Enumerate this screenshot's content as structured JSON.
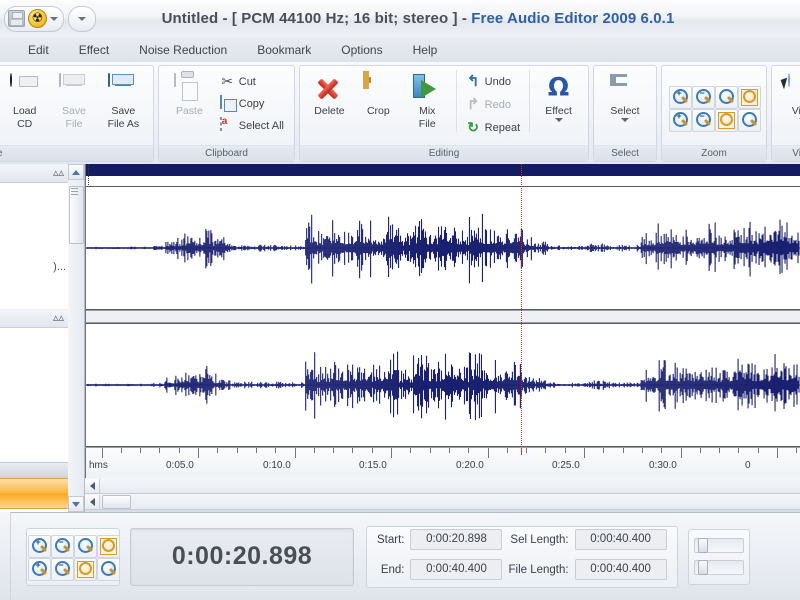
{
  "window": {
    "title_main": "Untitled - [ PCM 44100 Hz; 16 bit; stereo ] - ",
    "title_product": "Free Audio Editor 2009 6.0.1",
    "app_icon": "radiation-icon",
    "quick_access": [
      {
        "name": "save-icon",
        "label": ""
      },
      {
        "name": "app-radiation-icon",
        "label": ""
      },
      {
        "name": "chevron-down-icon",
        "label": ""
      },
      {
        "name": "customize-chevron-icon",
        "label": ""
      }
    ]
  },
  "menubar": {
    "items": [
      {
        "label": "Edit"
      },
      {
        "label": "Effect"
      },
      {
        "label": "Noise Reduction"
      },
      {
        "label": "Bookmark"
      },
      {
        "label": "Options"
      },
      {
        "label": "Help"
      }
    ]
  },
  "ribbon": {
    "groups": [
      {
        "title": "File",
        "title_visible": "e",
        "buttons": [
          {
            "label": "Load\nCD",
            "l1": "Load",
            "l2": "CD",
            "icon": "cd-icon",
            "enabled": true
          },
          {
            "label": "Save File",
            "l1": "Save",
            "l2": "File",
            "icon": "floppy-disabled-icon",
            "enabled": false
          },
          {
            "label": "Save File As",
            "l1": "Save",
            "l2": "File As",
            "icon": "floppy-icon",
            "enabled": true
          }
        ]
      },
      {
        "title": "Clipboard",
        "buttons": [
          {
            "l1": "Paste",
            "l2": "",
            "icon": "paste-icon",
            "enabled": false
          }
        ],
        "small_buttons": [
          {
            "label": "Cut",
            "icon": "scissors-icon",
            "enabled": true
          },
          {
            "label": "Copy",
            "icon": "copy-icon",
            "enabled": true
          },
          {
            "label": "Select All",
            "icon": "select-all-icon",
            "enabled": true
          }
        ]
      },
      {
        "title": "Editing",
        "buttons": [
          {
            "l1": "Delete",
            "l2": "",
            "icon": "delete-x-icon",
            "enabled": true
          },
          {
            "l1": "Crop",
            "l2": "",
            "icon": "crop-icon",
            "enabled": true
          },
          {
            "l1": "Mix",
            "l2": "File",
            "icon": "mix-file-icon",
            "enabled": true
          }
        ],
        "small_buttons": [
          {
            "label": "Undo",
            "icon": "undo-icon",
            "enabled": true
          },
          {
            "label": "Redo",
            "icon": "redo-icon",
            "enabled": false
          },
          {
            "label": "Repeat",
            "icon": "repeat-icon",
            "enabled": true
          }
        ],
        "effect_button": {
          "l1": "Effect",
          "icon": "omega-icon",
          "has_dropdown": true
        }
      },
      {
        "title": "Select",
        "buttons": [
          {
            "l1": "Select",
            "l2": "",
            "icon": "i-beam-icon",
            "has_dropdown": true,
            "enabled": true
          }
        ]
      },
      {
        "title": "Zoom",
        "zoom_buttons": [
          {
            "name": "zoom-in-icon"
          },
          {
            "name": "zoom-out-icon"
          },
          {
            "name": "zoom-selection-icon"
          },
          {
            "name": "zoom-full-icon"
          },
          {
            "name": "zoom-vertical-in-icon"
          },
          {
            "name": "zoom-vertical-out-icon"
          },
          {
            "name": "zoom-fit-vertical-icon"
          },
          {
            "name": "zoom-normal-icon"
          }
        ]
      },
      {
        "title": "View",
        "title_visible": "View",
        "buttons": [
          {
            "l1": "View",
            "l2": "",
            "icon": "view-cursor-icon",
            "has_dropdown": true,
            "enabled": true
          }
        ]
      }
    ]
  },
  "sidebar": {
    "panels": [
      {
        "collapse_icon": "chevron-up-icon",
        "truncated_text": ")..."
      },
      {
        "collapse_icon": "chevron-up-icon",
        "truncated_text": ""
      }
    ],
    "scrollbar": {
      "up_icon": "triangle-up-icon",
      "down_icon": "triangle-down-icon"
    }
  },
  "waveform": {
    "channels": 2,
    "wave_color": "#1b2170",
    "selection_bar_color": "#151b63",
    "playhead_color": "#c0392b",
    "playhead_time": "0:00:20.898"
  },
  "ruler": {
    "unit_label": "hms",
    "ticks": [
      "0:05.0",
      "0:10.0",
      "0:15.0",
      "0:20.0",
      "0:25.0",
      "0:30.0",
      "0"
    ]
  },
  "statusbar": {
    "current_time": "0:00:20.898",
    "fields": [
      {
        "label": "Start:",
        "value": "0:00:20.898"
      },
      {
        "label": "Sel Length:",
        "value": "0:00:40.400"
      },
      {
        "label": "End:",
        "value": "0:00:40.400"
      },
      {
        "label": "File Length:",
        "value": "0:00:40.400"
      }
    ],
    "zoom_buttons": [
      {
        "name": "zoom-in-icon"
      },
      {
        "name": "zoom-out-icon"
      },
      {
        "name": "zoom-selection-icon"
      },
      {
        "name": "zoom-full-icon"
      },
      {
        "name": "zoom-vertical-in-icon"
      },
      {
        "name": "zoom-vertical-out-icon"
      },
      {
        "name": "zoom-fit-vertical-icon"
      },
      {
        "name": "zoom-normal-icon"
      }
    ],
    "sliders": [
      {
        "name": "volume-slider"
      },
      {
        "name": "balance-slider"
      }
    ]
  },
  "colors": {
    "accent": "#2f5fa8",
    "wave": "#1b2170",
    "playhead": "#c0392b",
    "orange": "#f9a825"
  }
}
